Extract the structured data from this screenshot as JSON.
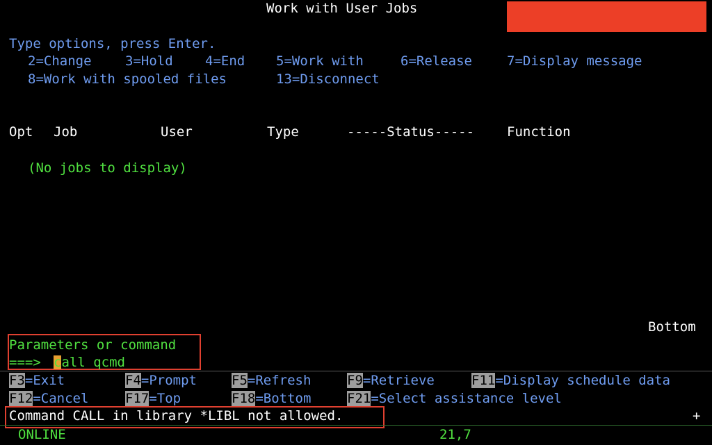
{
  "header": {
    "title": "Work with User Jobs"
  },
  "instructions": {
    "prompt": "Type options, press Enter.",
    "options_line1": [
      "2=Change",
      "3=Hold",
      "4=End",
      "5=Work with",
      "6=Release",
      "7=Display message"
    ],
    "options_line2": [
      "8=Work with spooled files",
      "13=Disconnect"
    ]
  },
  "table": {
    "columns": [
      "Opt",
      "Job",
      "User",
      "Type",
      "-----Status-----",
      "Function"
    ],
    "empty_message": "(No jobs to display)",
    "scroll_indicator": "Bottom"
  },
  "command": {
    "label": "Parameters or command",
    "prompt": "===>",
    "value": "call qcmd"
  },
  "function_keys": {
    "row1": [
      {
        "key": "F3",
        "label": "=Exit"
      },
      {
        "key": "F4",
        "label": "=Prompt"
      },
      {
        "key": "F5",
        "label": "=Refresh"
      },
      {
        "key": "F9",
        "label": "=Retrieve"
      },
      {
        "key": "F11",
        "label": "=Display schedule data"
      }
    ],
    "row2": [
      {
        "key": "F12",
        "label": "=Cancel"
      },
      {
        "key": "F17",
        "label": "=Top"
      },
      {
        "key": "F18",
        "label": "=Bottom"
      },
      {
        "key": "F21",
        "label": "=Select assistance level"
      }
    ]
  },
  "message": {
    "text": "Command CALL in library *LIBL not allowed.",
    "more": "+"
  },
  "status": {
    "state": "ONLINE",
    "cursor_position": "21,7"
  },
  "colors": {
    "highlight": "#ec3f27",
    "box": "#e04030",
    "text_blue": "#6f9cf0",
    "text_green": "#50e040"
  }
}
